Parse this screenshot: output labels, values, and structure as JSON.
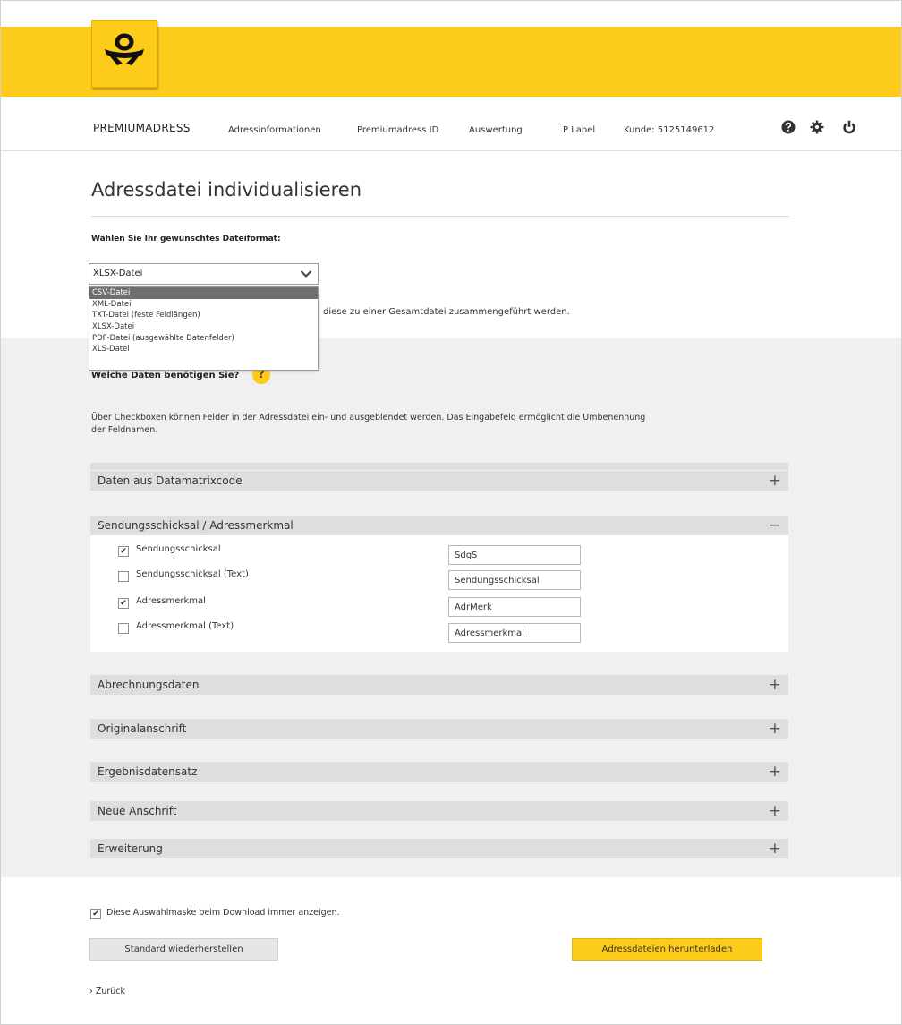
{
  "header": {
    "brand": "PREMIUMADRESS",
    "nav": [
      "Adressinformationen",
      "Premiumadress ID",
      "Auswertung",
      "P Label",
      "Kunde: 5125149612"
    ]
  },
  "icons": {
    "logo": "post-horn-icon",
    "help": "help-icon",
    "settings": "gear-icon",
    "logout": "power-icon"
  },
  "colors": {
    "brand_yellow": "#fdcb19",
    "section_gray": "#dedede"
  },
  "page": {
    "title": "Adressdatei individualisieren",
    "format_label": "Wählen Sie Ihr gewünschtes Dateiformat:",
    "merge_text": "diese zu einer Gesamtdatei zusammengeführt werden."
  },
  "format_select": {
    "value": "XLSX-Datei",
    "options": [
      "CSV-Datei",
      "XML-Datei",
      "TXT-Datei (feste Feldlängen)",
      "XLSX-Datei",
      "PDF-Datei (ausgewählte Datenfelder)",
      "XLS-Datei"
    ],
    "highlighted": "CSV-Datei"
  },
  "data_section": {
    "question": "Welche Daten benötigen Sie?",
    "help_label": "?",
    "description": "Über Checkboxen können Felder in der Adressdatei ein- und ausgeblendet werden. Das Eingabefeld ermöglicht die Umbenennung der Feldnamen."
  },
  "sections": [
    {
      "label": "Daten aus Datamatrixcode",
      "toggle": "+"
    },
    {
      "label": "Sendungsschicksal / Adressmerkmal",
      "toggle": "−"
    },
    {
      "label": "Abrechnungsdaten",
      "toggle": "+"
    },
    {
      "label": "Originalanschrift",
      "toggle": "+"
    },
    {
      "label": "Ergebnisdatensatz",
      "toggle": "+"
    },
    {
      "label": "Neue Anschrift",
      "toggle": "+"
    },
    {
      "label": "Erweiterung",
      "toggle": "+"
    }
  ],
  "fields": [
    {
      "label": "Sendungsschicksal",
      "checked": true,
      "check": "✔",
      "value": "SdgS"
    },
    {
      "label": "Sendungsschicksal (Text)",
      "checked": false,
      "check": "",
      "value": "Sendungsschicksal"
    },
    {
      "label": "Adressmerkmal",
      "checked": true,
      "check": "✔",
      "value": "AdrMerk"
    },
    {
      "label": "Adressmerkmal (Text)",
      "checked": false,
      "check": "",
      "value": "Adressmerkmal"
    }
  ],
  "footer": {
    "show_mask_label": "Diese Auswahlmaske beim Download immer anzeigen.",
    "show_mask_check": "✔",
    "reset_button": "Standard wiederherstellen",
    "download_button": "Adressdateien herunterladen",
    "back_link": "› Zurück"
  }
}
